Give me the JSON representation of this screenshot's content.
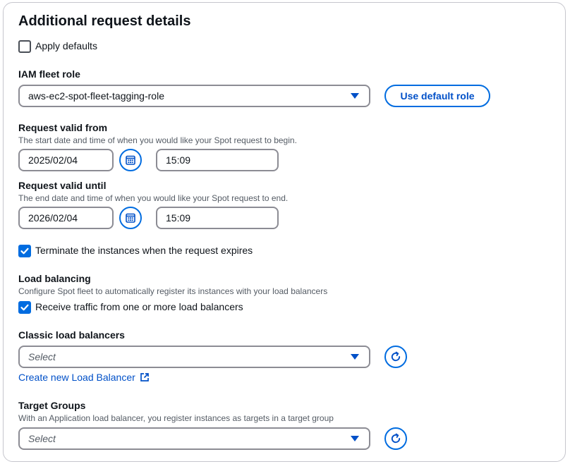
{
  "section": {
    "title": "Additional request details"
  },
  "apply_defaults": {
    "label": "Apply defaults",
    "checked": false
  },
  "iam": {
    "label": "IAM fleet role",
    "value": "aws-ec2-spot-fleet-tagging-role",
    "default_button": "Use default role"
  },
  "valid_from": {
    "label": "Request valid from",
    "description": "The start date and time of when you would like your Spot request to begin.",
    "date": "2025/02/04",
    "time": "15:09"
  },
  "valid_until": {
    "label": "Request valid until",
    "description": "The end date and time of when you would like your Spot request to end.",
    "date": "2026/02/04",
    "time": "15:09"
  },
  "terminate": {
    "label": "Terminate the instances when the request expires",
    "checked": true
  },
  "load_balancing": {
    "label": "Load balancing",
    "description": "Configure Spot fleet to automatically register its instances with your load balancers",
    "receive_label": "Receive traffic from one or more load balancers",
    "receive_checked": true
  },
  "classic_lb": {
    "label": "Classic load balancers",
    "placeholder": "Select",
    "create_link": "Create new Load Balancer"
  },
  "target_groups": {
    "label": "Target Groups",
    "description": "With an Application load balancer, you register instances as targets in a target group",
    "placeholder": "Select"
  },
  "colors": {
    "accent": "#006ce0",
    "link": "#0050c8",
    "border": "#8c8c94"
  },
  "icons": {
    "calendar": "calendar-icon",
    "refresh": "refresh-icon",
    "external": "external-link-icon",
    "check": "check-icon",
    "caret": "caret-down-icon"
  }
}
